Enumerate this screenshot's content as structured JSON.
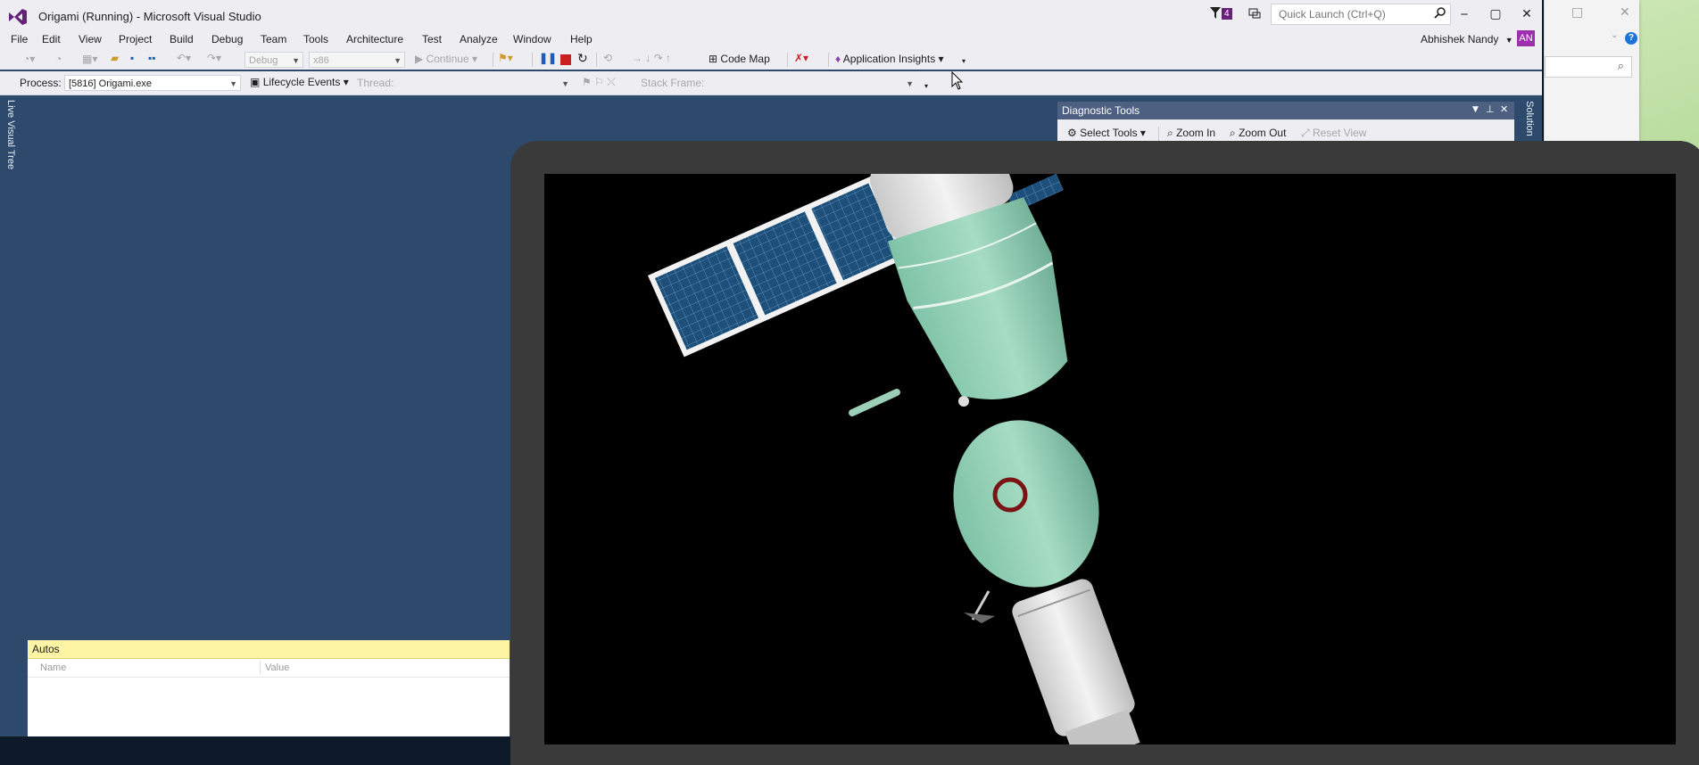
{
  "window": {
    "title": "Origami (Running) - Microsoft Visual Studio",
    "notification_count": "4",
    "quick_launch_placeholder": "Quick Launch (Ctrl+Q)",
    "account_name": "Abhishek Nandy",
    "account_initials": "AN"
  },
  "menu": [
    "File",
    "Edit",
    "View",
    "Project",
    "Build",
    "Debug",
    "Team",
    "Tools",
    "Architecture",
    "Test",
    "Analyze",
    "Window",
    "Help"
  ],
  "toolbar1": {
    "config": "Debug",
    "platform": "x86",
    "continue_label": "Continue",
    "code_map_label": "Code Map",
    "app_insights_label": "Application Insights"
  },
  "toolbar2": {
    "process_label": "Process:",
    "process_value": "[5816] Origami.exe",
    "lifecycle_label": "Lifecycle Events",
    "thread_label": "Thread:",
    "stack_frame_label": "Stack Frame:"
  },
  "side_tabs": {
    "left": "Live Visual Tree",
    "right": "Solution"
  },
  "diagnostic_tools": {
    "title": "Diagnostic Tools",
    "select_tools": "Select Tools",
    "zoom_in": "Zoom In",
    "zoom_out": "Zoom Out",
    "reset_view": "Reset View"
  },
  "autos": {
    "title": "Autos",
    "columns": [
      "Name",
      "Value"
    ]
  },
  "colors": {
    "vs_accent": "#68217a",
    "editor_bg": "#2d4a6d",
    "autos_header": "#fdf4a4",
    "diag_title": "#4d6082"
  },
  "icons": [
    "vs-logo-icon",
    "notification-flag-icon",
    "feedback-icon",
    "search-icon",
    "minimize-icon",
    "maximize-icon",
    "close-icon",
    "pause-icon",
    "stop-icon",
    "restart-icon",
    "code-map-icon",
    "application-insights-icon",
    "gear-icon",
    "zoom-in-icon",
    "zoom-out-icon",
    "help-icon"
  ]
}
